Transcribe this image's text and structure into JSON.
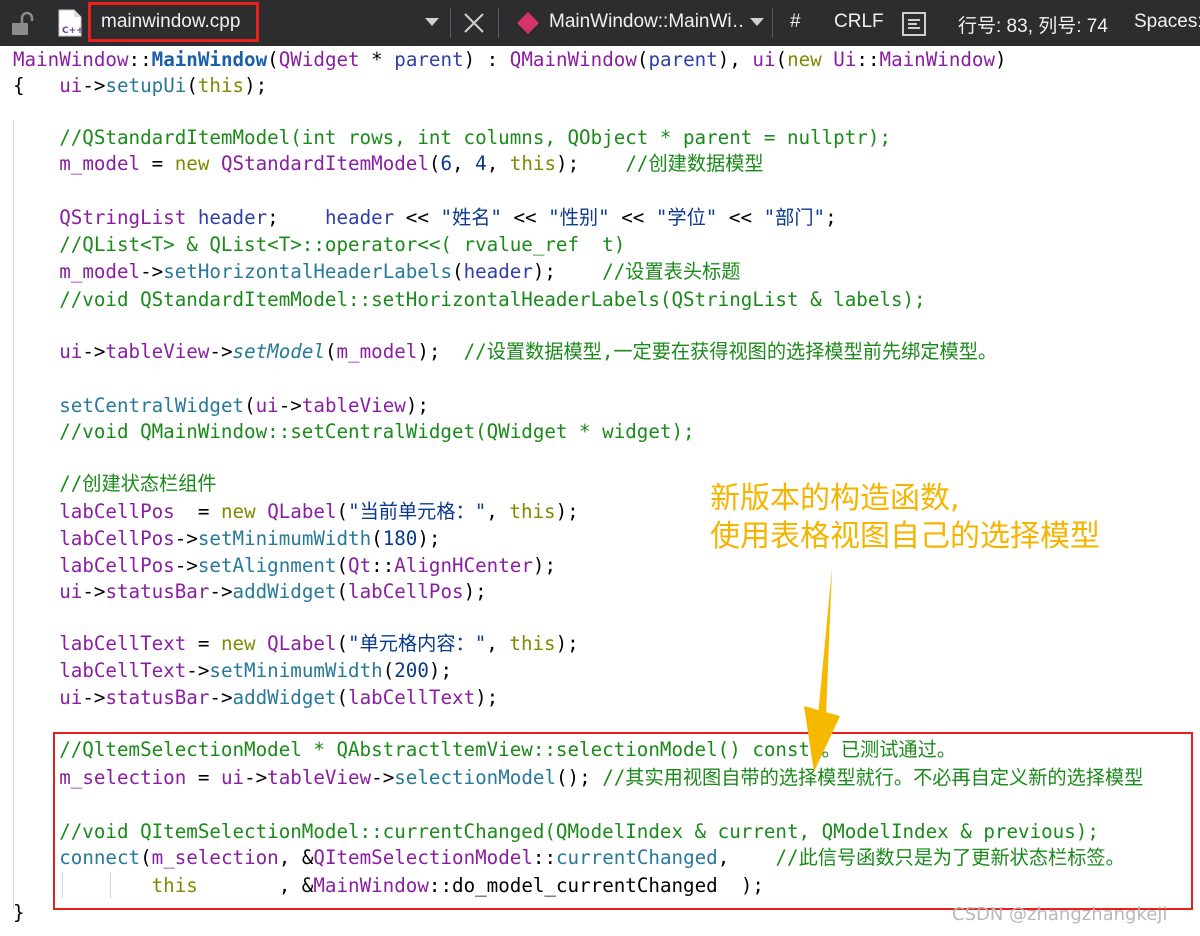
{
  "toolbar": {
    "file_tab": "mainwindow.cpp",
    "symbol": "MainWindow::MainWi…",
    "hash_label": "#",
    "eol": "CRLF",
    "position": "行号: 83, 列号: 74",
    "indent": "Spaces:"
  },
  "code": {
    "l1": {
      "a": "MainWindow",
      "b": "::",
      "c": "MainWindow",
      "d": "(",
      "e": "QWidget",
      "f": " * ",
      "g": "parent",
      "h": ") : ",
      "i": "QMainWindow",
      "j": "(",
      "k": "parent",
      "l": "), ",
      "m": "ui",
      "n": "(",
      "o": "new",
      "p": " ",
      "q": "Ui",
      "r": "::",
      "s": "MainWindow",
      "t": ")"
    },
    "l2": {
      "a": "{   ",
      "b": "ui",
      "c": "->",
      "d": "setupUi",
      "e": "(",
      "f": "this",
      "g": ");"
    },
    "l3": "    //QStandardItemModel(int rows, int columns, QObject * parent = nullptr);",
    "l4": {
      "a": "    ",
      "b": "m_model",
      "c": " = ",
      "d": "new",
      "e": " ",
      "f": "QStandardItemModel",
      "g": "(",
      "h": "6",
      "i": ", ",
      "j": "4",
      "k": ", ",
      "l": "this",
      "m": ");    ",
      "n": "//创建数据模型"
    },
    "l5": {
      "a": "    ",
      "b": "QStringList",
      "c": " ",
      "d": "header",
      "e": ";    ",
      "f": "header",
      "g": " << ",
      "h": "\"姓名\"",
      "i": " << ",
      "j": "\"性别\"",
      "k": " << ",
      "l": "\"学位\"",
      "m": " << ",
      "n": "\"部门\"",
      "o": ";"
    },
    "l6": "    //QList<T> & QList<T>::operator<<( rvalue_ref  t)",
    "l7": {
      "a": "    ",
      "b": "m_model",
      "c": "->",
      "d": "setHorizontalHeaderLabels",
      "e": "(",
      "f": "header",
      "g": ");    ",
      "h": "//设置表头标题"
    },
    "l8": "    //void QStandardItemModel::setHorizontalHeaderLabels(QStringList & labels);",
    "l9": {
      "a": "    ",
      "b": "ui",
      "c": "->",
      "d": "tableView",
      "e": "->",
      "f": "setModel",
      "g": "(",
      "h": "m_model",
      "i": ");  ",
      "j": "//设置数据模型,一定要在获得视图的选择模型前先绑定模型。"
    },
    "l10": {
      "a": "    ",
      "b": "setCentralWidget",
      "c": "(",
      "d": "ui",
      "e": "->",
      "f": "tableView",
      "g": ");"
    },
    "l11": "    //void QMainWindow::setCentralWidget(QWidget * widget);",
    "l12": "    //创建状态栏组件",
    "l13": {
      "a": "    ",
      "b": "labCellPos",
      "c": "  = ",
      "d": "new",
      "e": " ",
      "f": "QLabel",
      "g": "(",
      "h": "\"当前单元格：\"",
      "i": ", ",
      "j": "this",
      "k": ");"
    },
    "l14": {
      "a": "    ",
      "b": "labCellPos",
      "c": "->",
      "d": "setMinimumWidth",
      "e": "(",
      "f": "180",
      "g": ");"
    },
    "l15": {
      "a": "    ",
      "b": "labCellPos",
      "c": "->",
      "d": "setAlignment",
      "e": "(",
      "f": "Qt",
      "g": "::",
      "h": "AlignHCenter",
      "i": ");"
    },
    "l16": {
      "a": "    ",
      "b": "ui",
      "c": "->",
      "d": "statusBar",
      "e": "->",
      "f": "addWidget",
      "g": "(",
      "h": "labCellPos",
      "i": ");"
    },
    "l17": {
      "a": "    ",
      "b": "labCellText",
      "c": " = ",
      "d": "new",
      "e": " ",
      "f": "QLabel",
      "g": "(",
      "h": "\"单元格内容：\"",
      "i": ", ",
      "j": "this",
      "k": ");"
    },
    "l18": {
      "a": "    ",
      "b": "labCellText",
      "c": "->",
      "d": "setMinimumWidth",
      "e": "(",
      "f": "200",
      "g": ");"
    },
    "l19": {
      "a": "    ",
      "b": "ui",
      "c": "->",
      "d": "statusBar",
      "e": "->",
      "f": "addWidget",
      "g": "(",
      "h": "labCellText",
      "i": ");"
    },
    "l20": "    //QltemSelectionModel * QAbstractltemView::selectionModel() const 。已测试通过。",
    "l21": {
      "a": "    ",
      "b": "m_selection",
      "c": " = ",
      "d": "ui",
      "e": "->",
      "f": "tableView",
      "g": "->",
      "h": "selectionModel",
      "i": "(); ",
      "j": "//其实用视图自带的选择模型就行。不必再自定义新的选择模型"
    },
    "l22": "    //void QItemSelectionModel::currentChanged(QModelIndex & current, QModelIndex & previous);",
    "l23": {
      "a": "    ",
      "b": "connect",
      "c": "(",
      "d": "m_selection",
      "e": ", &",
      "f": "QItemSelectionModel",
      "g": "::",
      "h": "currentChanged",
      "i": ",    ",
      "j": "//此信号函数只是为了更新状态栏标签。"
    },
    "l24": {
      "a": "            ",
      "b": "this",
      "c": "       , &",
      "d": "MainWindow",
      "e": "::",
      "f": "do_model_currentChanged",
      "g": "  );"
    },
    "l25": "}"
  },
  "annotation": "新版本的构造函数,\n使用表格视图自己的选择模型",
  "watermark": "CSDN @zhangzhangkeji",
  "colors": {
    "toolbar_bg": "#2d2d30",
    "highlight_red": "#e8201b",
    "annotation_yellow": "#f5b400"
  }
}
